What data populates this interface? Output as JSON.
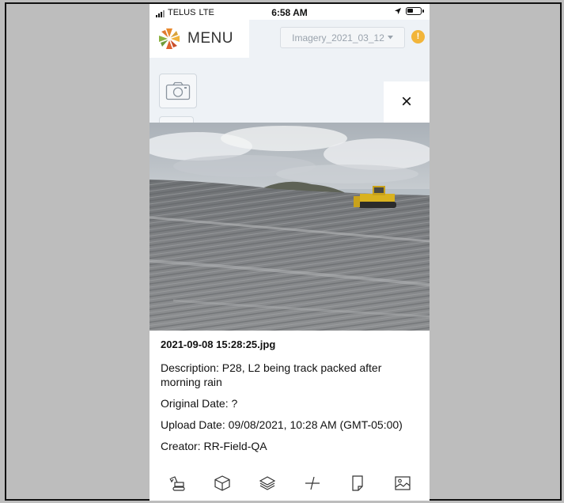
{
  "status_bar": {
    "carrier": "TELUS",
    "network": "LTE",
    "time": "6:58 AM"
  },
  "header": {
    "menu_label": "MENU",
    "imagery_select": "Imagery_2021_03_12",
    "warning_badge": "!"
  },
  "viewer": {
    "close_label": "×",
    "file_name": "2021-09-08 15:28:25.jpg",
    "description": "Description: P28, L2 being track packed after morning rain",
    "original_date": "Original Date: ?",
    "upload_date": "Upload Date: 09/08/2021, 10:28 AM (GMT-05:00)",
    "creator": "Creator: RR-Field-QA"
  },
  "toolbar": {
    "items": [
      "excavator-icon",
      "cube-icon",
      "layers-icon",
      "measure-icon",
      "note-icon",
      "image-icon"
    ]
  },
  "colors": {
    "accent_orange": "#e8892d",
    "warning": "#f2b53a",
    "frame_background": "#bdbdbd"
  }
}
